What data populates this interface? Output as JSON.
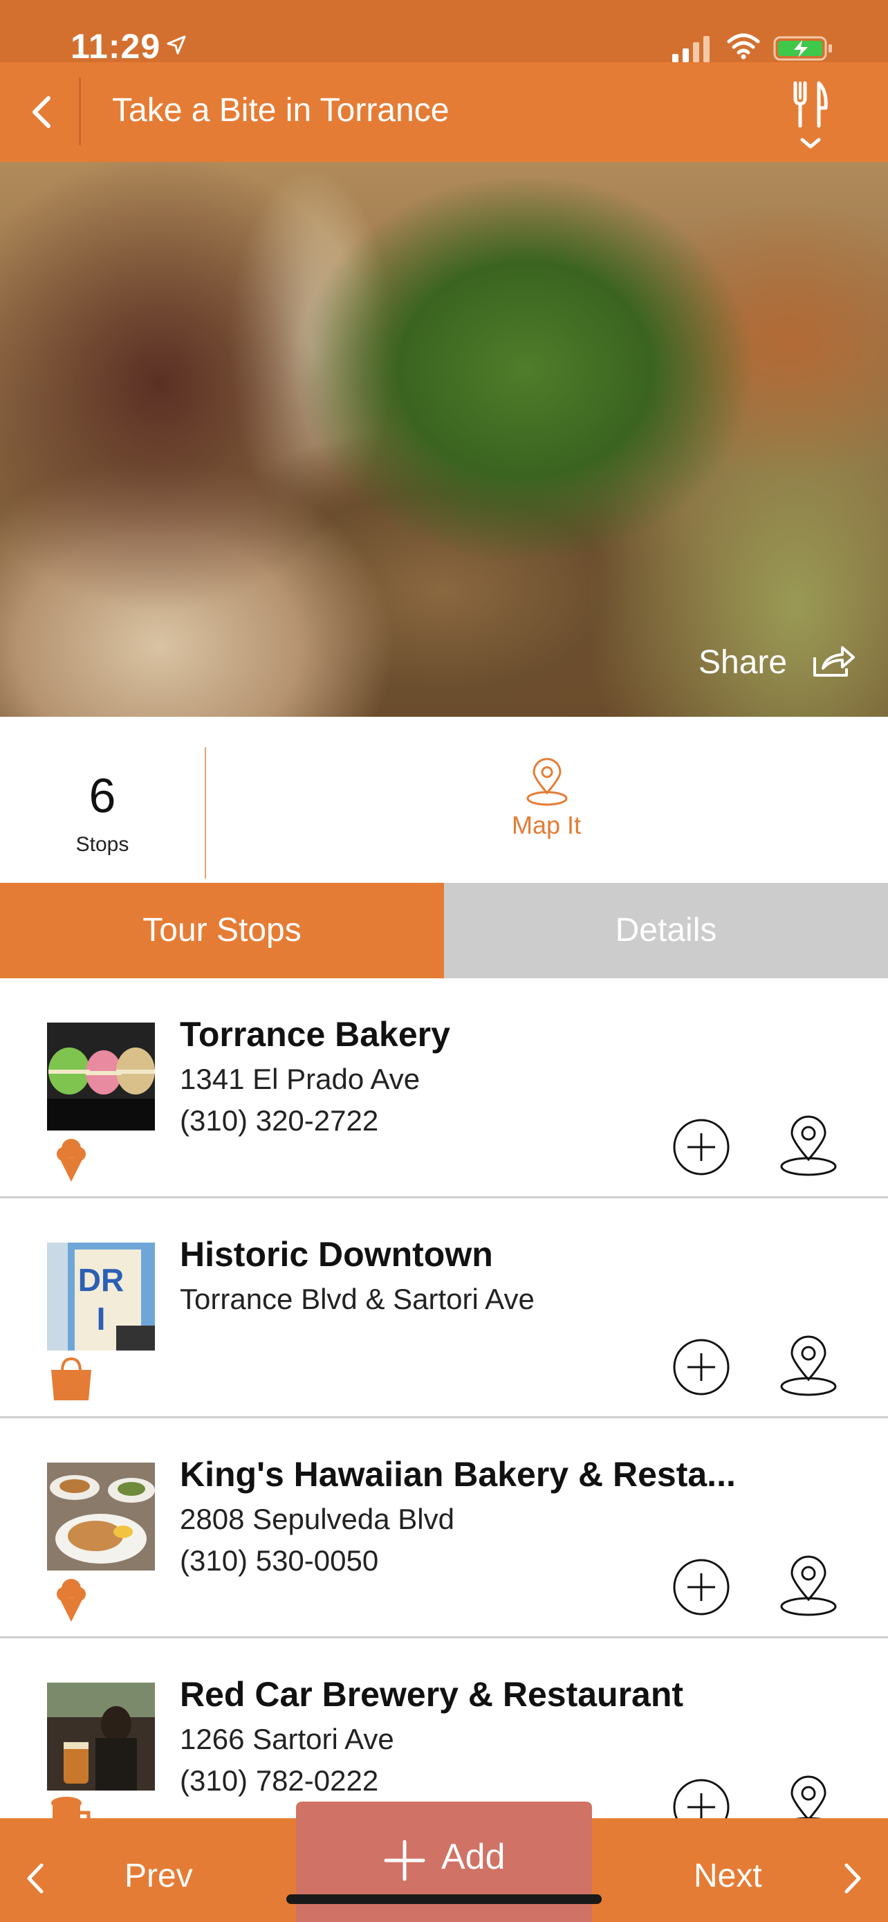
{
  "status_bar": {
    "time": "11:29"
  },
  "nav": {
    "title": "Take a Bite in Torrance"
  },
  "hero": {
    "share_label": "Share"
  },
  "stats": {
    "stops_count": "6",
    "stops_label": "Stops",
    "map_label": "Map It"
  },
  "tabs": [
    {
      "label": "Tour Stops",
      "active": true
    },
    {
      "label": "Details",
      "active": false
    }
  ],
  "stops": [
    {
      "name": "Torrance Bakery",
      "line1": "1341 El Prado Ave",
      "line2": "(310) 320-2722",
      "category_icon": "ice-cream-icon"
    },
    {
      "name": "Historic Downtown",
      "line1": "Torrance Blvd & Sartori Ave",
      "line2": "",
      "category_icon": "shopping-bag-icon"
    },
    {
      "name": "King's Hawaiian Bakery & Resta...",
      "line1": "2808 Sepulveda Blvd",
      "line2": "(310) 530-0050",
      "category_icon": "ice-cream-icon"
    },
    {
      "name": "Red Car Brewery & Restaurant",
      "line1": "1266 Sartori Ave",
      "line2": "(310) 782-0222",
      "category_icon": "beer-mug-icon"
    }
  ],
  "bottom_bar": {
    "prev_label": "Prev",
    "add_label": "Add",
    "next_label": "Next"
  },
  "colors": {
    "accent": "#e57c35",
    "status_bar": "#d4702f",
    "inactive_tab": "#cccccc",
    "add_button": "#d07265"
  }
}
